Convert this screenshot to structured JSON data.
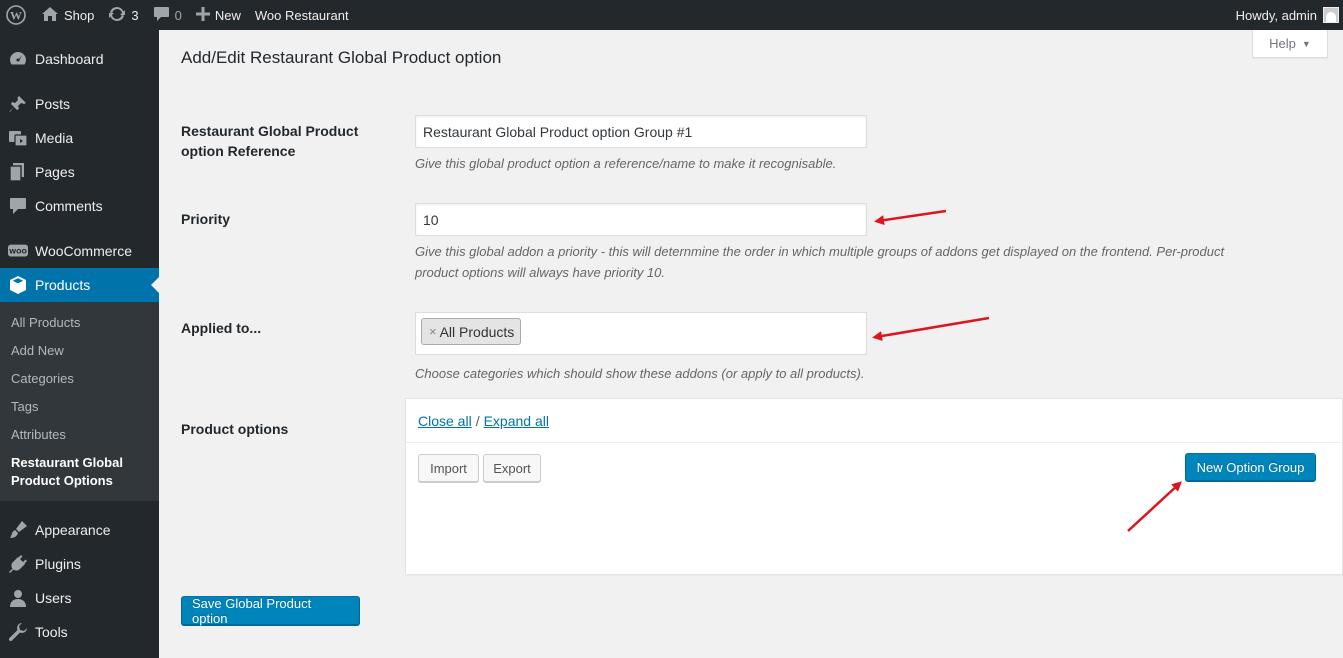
{
  "adminbar": {
    "site_name": "Shop",
    "updates_count": "3",
    "comments_count": "0",
    "new_label": "New",
    "plugin_label": "Woo Restaurant",
    "howdy": "Howdy, admin"
  },
  "sidebar": {
    "items": [
      {
        "label": "Dashboard",
        "icon": "dashboard-icon"
      },
      {
        "label": "Posts",
        "icon": "pin-icon"
      },
      {
        "label": "Media",
        "icon": "media-icon"
      },
      {
        "label": "Pages",
        "icon": "pages-icon"
      },
      {
        "label": "Comments",
        "icon": "comment-icon"
      },
      {
        "label": "WooCommerce",
        "icon": "woo-icon"
      },
      {
        "label": "Products",
        "icon": "product-box-icon"
      },
      {
        "label": "Appearance",
        "icon": "brush-icon"
      },
      {
        "label": "Plugins",
        "icon": "plug-icon"
      },
      {
        "label": "Users",
        "icon": "user-icon"
      },
      {
        "label": "Tools",
        "icon": "wrench-icon"
      }
    ],
    "products_submenu": [
      "All Products",
      "Add New",
      "Categories",
      "Tags",
      "Attributes",
      "Restaurant Global Product Options"
    ]
  },
  "help": {
    "label": "Help"
  },
  "page": {
    "title": "Add/Edit Restaurant Global Product option",
    "reference": {
      "label": "Restaurant Global Product option Reference",
      "value": "Restaurant Global Product option Group #1",
      "description": "Give this global product option a reference/name to make it recognisable."
    },
    "priority": {
      "label": "Priority",
      "value": "10",
      "description_line1": "Give this global addon a priority - this will deternmine the order in which multiple groups of addons get displayed on the frontend. Per-product",
      "description_line2": "product options will always have priority 10."
    },
    "applied_to": {
      "label": "Applied to...",
      "chip_remove": "×",
      "chip": "All Products",
      "description": "Choose categories which should show these addons (or apply to all products)."
    },
    "product_options": {
      "label": "Product options",
      "close_all": "Close all",
      "separator": "/",
      "expand_all": "Expand all",
      "import": "Import",
      "export": "Export",
      "new_group": "New Option Group"
    },
    "save_button": "Save Global Product option"
  },
  "colors": {
    "admin_bar": "#23282d",
    "active_menu": "#0073aa",
    "primary_button": "#0085ba",
    "annotation_arrow": "#e0141e"
  }
}
